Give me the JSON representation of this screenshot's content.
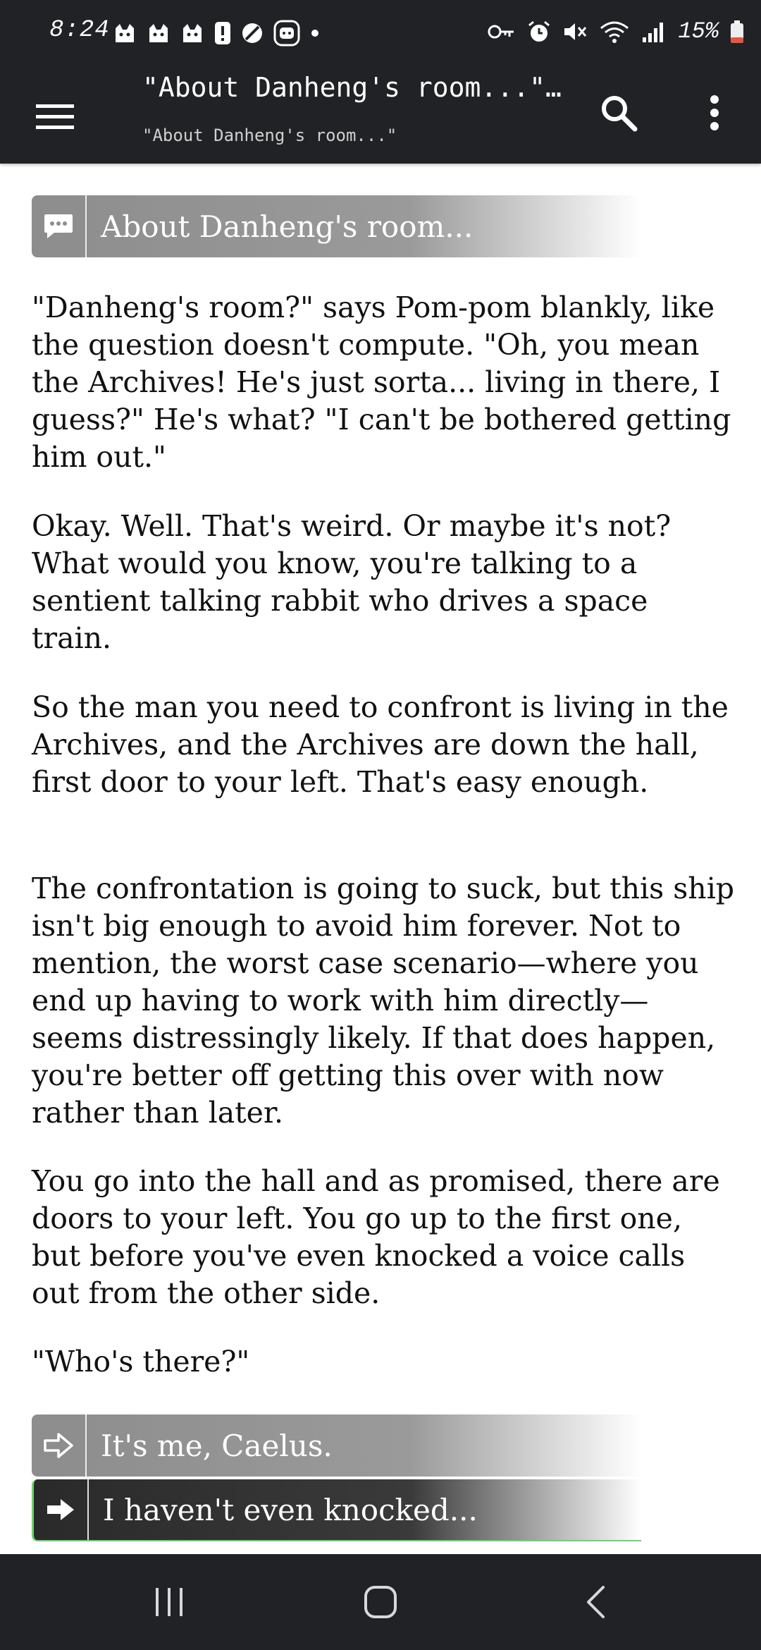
{
  "status_bar": {
    "time": "8:24",
    "left_icons": [
      "cat-face-icon",
      "cat-face-icon",
      "cat-face-icon",
      "alert-badge-icon",
      "no-entry-icon",
      "app-badge-icon",
      "dot-icon"
    ],
    "right_icons": [
      "key-icon",
      "alarm-icon",
      "mute-icon",
      "wifi-icon",
      "signal-icon"
    ],
    "battery_text": "15%",
    "battery_color": "#e8553f"
  },
  "app_bar": {
    "title": "\"About Danheng's room...\"…",
    "subtitle": "\"About Danheng's room...\"",
    "icons": [
      "menu-icon",
      "search-icon",
      "more-vert-icon"
    ]
  },
  "passage": {
    "header_label": "About Danheng's room...",
    "header_icon": "speech-bubble-icon",
    "paragraphs": [
      "\"Danheng's room?\" says Pom-pom blankly, like the question doesn't compute. \"Oh, you mean the Archives! He's just sorta... living in there, I guess?\" He's what? \"I can't be bothered getting him out.\"",
      "Okay. Well. That's weird. Or maybe it's not? What would you know, you're talking to a sentient talking rabbit who drives a space train.",
      "So the man you need to confront is living in the Archives, and the Archives are down the hall, first door to your left. That's easy enough.",
      "The confrontation is going to suck, but this ship isn't big enough to avoid him forever. Not to mention, the worst case scenario—where you end up having to work with him directly—seems distressingly likely. If that does happen, you're better off getting this over with now rather than later.",
      "You go into the hall and as promised, there are doors to your left. You go up to the first one, but before you've even knocked a voice calls out from the other side.",
      "\"Who's there?\""
    ]
  },
  "choices": [
    {
      "label": "It's me, Caelus.",
      "icon": "arrow-outline-icon"
    },
    {
      "label": "I haven't even knocked...",
      "icon": "arrow-solid-icon"
    }
  ],
  "nav_bar": {
    "icons": [
      "recents-icon",
      "home-icon",
      "back-icon"
    ]
  },
  "colors": {
    "bar_background": "#202225",
    "choice_gray": "#9a9a9a",
    "choice_dark": "#2a2a2a",
    "selected_outline": "#6fd36f"
  }
}
